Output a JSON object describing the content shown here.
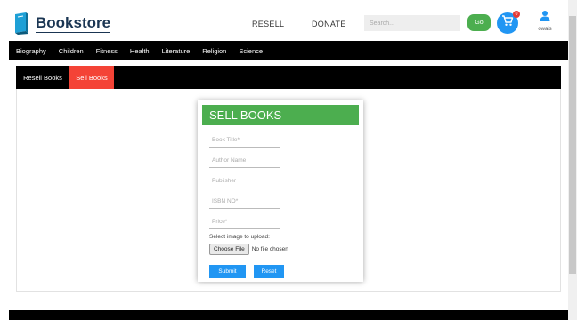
{
  "header": {
    "brand": "Bookstore",
    "nav": {
      "resell": "RESELL",
      "donate": "DONATE"
    },
    "search_placeholder": "Search...",
    "go_label": "Go",
    "cart_count": "0",
    "user_name": "owais"
  },
  "categories": [
    "Biography",
    "Children",
    "Fitness",
    "Health",
    "Literature",
    "Religion",
    "Science"
  ],
  "tabs": {
    "resell": "Resell Books",
    "sell": "Sell Books"
  },
  "form": {
    "title": "SELL BOOKS",
    "fields": {
      "title": "Book Title*",
      "author": "Author Name",
      "publisher": "Publisher",
      "isbn": "ISBN NO*",
      "price": "Price*"
    },
    "upload_label": "Select image to upload:",
    "choose_file": "Choose File",
    "file_status": "No file chosen",
    "submit": "Submit",
    "reset": "Reset"
  },
  "colors": {
    "brand": "#1a3552",
    "green": "#4cae4f",
    "blue": "#2196f3",
    "red": "#f44336",
    "black": "#000000"
  },
  "icons": {
    "logo": "book-icon",
    "cart": "cart-icon",
    "user": "user-icon"
  }
}
